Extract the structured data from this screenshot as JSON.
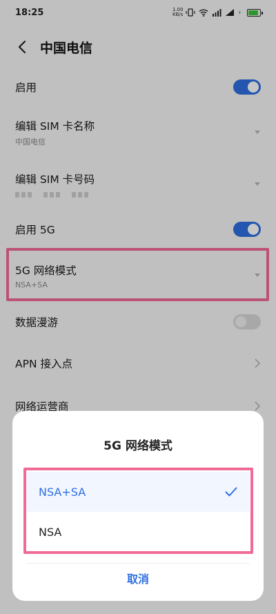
{
  "status_bar": {
    "time": "18:25",
    "net_speed_top": "1.00",
    "net_speed_bottom": "KB/s",
    "battery_level": 0.9,
    "battery_label": "90",
    "battery_color": "#3cc13c"
  },
  "header": {
    "title": "中国电信"
  },
  "settings": {
    "enable": {
      "label": "启用",
      "on": true
    },
    "edit_name": {
      "label": "编辑 SIM 卡名称",
      "value": "中国电信"
    },
    "edit_number": {
      "label": "编辑 SIM 卡号码"
    },
    "enable_5g": {
      "label": "启用 5G",
      "on": true
    },
    "network_mode": {
      "label": "5G 网络模式",
      "value": "NSA+SA"
    },
    "roaming": {
      "label": "数据漫游",
      "on": false
    },
    "apn": {
      "label": "APN 接入点"
    },
    "carrier": {
      "label": "网络运营商"
    }
  },
  "dialog": {
    "title": "5G 网络模式",
    "options": [
      {
        "label": "NSA+SA",
        "selected": true
      },
      {
        "label": "NSA",
        "selected": false
      }
    ],
    "cancel_label": "取消"
  },
  "colors": {
    "accent": "#2f6fe0",
    "highlight": "#f06a96"
  }
}
